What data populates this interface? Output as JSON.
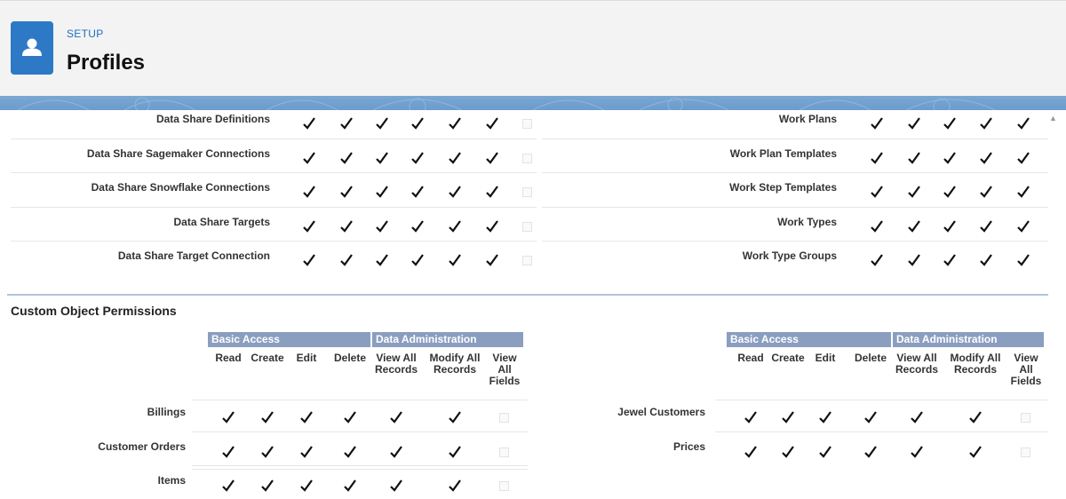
{
  "header": {
    "setup_label": "SETUP",
    "title": "Profiles",
    "icon": "user-icon",
    "brand_color": "#2d79c5"
  },
  "standard_objects": {
    "left_rows": [
      {
        "label": "Data Share Definitions",
        "perms": [
          true,
          true,
          true,
          true,
          true,
          true,
          false
        ]
      },
      {
        "label": "Data Share Sagemaker Connections",
        "perms": [
          true,
          true,
          true,
          true,
          true,
          true,
          false
        ]
      },
      {
        "label": "Data Share Snowflake Connections",
        "perms": [
          true,
          true,
          true,
          true,
          true,
          true,
          false
        ]
      },
      {
        "label": "Data Share Targets",
        "perms": [
          true,
          true,
          true,
          true,
          true,
          true,
          false
        ]
      },
      {
        "label": "Data Share Target Connection",
        "perms": [
          true,
          true,
          true,
          true,
          true,
          true,
          false
        ]
      }
    ],
    "right_rows": [
      {
        "label": "Work Plans",
        "perms": [
          true,
          true,
          true,
          true,
          true
        ]
      },
      {
        "label": "Work Plan Templates",
        "perms": [
          true,
          true,
          true,
          true,
          true
        ]
      },
      {
        "label": "Work Step Templates",
        "perms": [
          true,
          true,
          true,
          true,
          true
        ]
      },
      {
        "label": "Work Types",
        "perms": [
          true,
          true,
          true,
          true,
          true
        ]
      },
      {
        "label": "Work Type Groups",
        "perms": [
          true,
          true,
          true,
          true,
          true
        ]
      }
    ]
  },
  "custom_objects": {
    "section_title": "Custom Object Permissions",
    "group_basic": "Basic Access",
    "group_admin": "Data Administration",
    "columns": [
      "Read",
      "Create",
      "Edit",
      "Delete",
      "View All\nRecords",
      "Modify All\nRecords",
      "View\nAll\nFields"
    ],
    "left_rows": [
      {
        "label": "Billings",
        "perms": [
          true,
          true,
          true,
          true,
          true,
          true,
          false
        ]
      },
      {
        "label": "Customer Orders",
        "perms": [
          true,
          true,
          true,
          true,
          true,
          true,
          false
        ]
      },
      {
        "label": "Items",
        "perms": [
          true,
          true,
          true,
          true,
          true,
          true,
          false
        ]
      }
    ],
    "right_rows": [
      {
        "label": "Jewel Customers",
        "perms": [
          true,
          true,
          true,
          true,
          true,
          true,
          false
        ]
      },
      {
        "label": "Prices",
        "perms": [
          true,
          true,
          true,
          true,
          true,
          true,
          false
        ]
      }
    ]
  }
}
